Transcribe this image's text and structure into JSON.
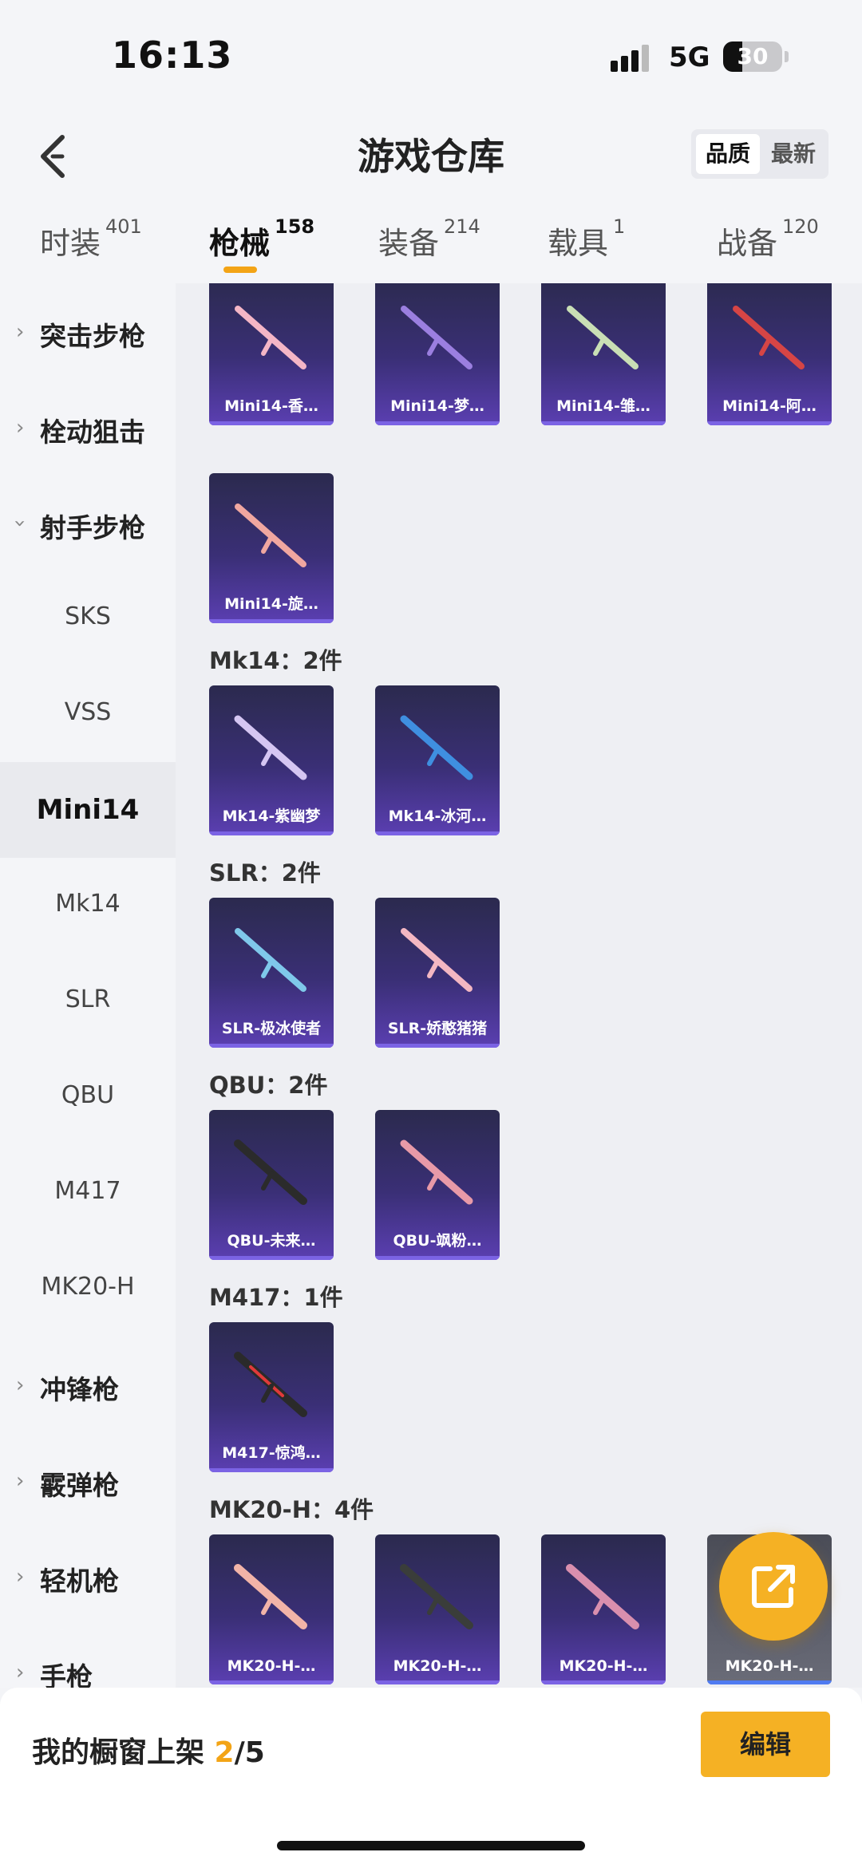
{
  "status": {
    "time": "16:13",
    "network": "5G",
    "battery": "30"
  },
  "header": {
    "title": "游戏仓库",
    "sort_quality": "品质",
    "sort_newest": "最新"
  },
  "tabs": [
    {
      "label": "时装",
      "count": "401"
    },
    {
      "label": "枪械",
      "count": "158"
    },
    {
      "label": "装备",
      "count": "214"
    },
    {
      "label": "载具",
      "count": "1"
    },
    {
      "label": "战备",
      "count": "120"
    }
  ],
  "sidebar": {
    "categories": [
      "突击步枪",
      "栓动狙击",
      "射手步枪",
      "冲锋枪",
      "霰弹枪",
      "轻机枪",
      "手枪"
    ],
    "subs": [
      "SKS",
      "VSS",
      "Mini14",
      "Mk14",
      "SLR",
      "QBU",
      "M417",
      "MK20-H"
    ]
  },
  "groups": [
    {
      "label": "Mk14：2件"
    },
    {
      "label": "SLR：2件"
    },
    {
      "label": "QBU：2件"
    },
    {
      "label": "M417：1件"
    },
    {
      "label": "MK20-H：4件"
    }
  ],
  "cards": [
    "Mini14-香…",
    "Mini14-梦…",
    "Mini14-雏…",
    "Mini14-阿…",
    "Mini14-旋…",
    "Mk14-紫幽梦",
    "Mk14-冰河…",
    "SLR-极冰使者",
    "SLR-娇憨猪猪",
    "QBU-未来…",
    "QBU-飒粉…",
    "M417-惊鸿…",
    "MK20-H-…",
    "MK20-H-…",
    "MK20-H-…",
    "MK20-H-…"
  ],
  "bottom": {
    "shelf_prefix": "我的橱窗上架 ",
    "shelf_current": "2",
    "shelf_total": "/5",
    "edit_label": "编辑"
  },
  "colors": {
    "accent": "#f3a416",
    "card_purple": "#3a2f76"
  },
  "icons": {
    "back": "chevron-left-icon",
    "share": "external-share-icon"
  }
}
